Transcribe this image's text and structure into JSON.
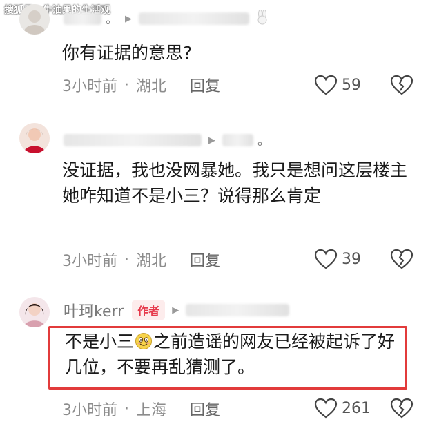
{
  "watermark": "搜狐号@牛油果的生活观",
  "comments": [
    {
      "text": "你有证据的意思?",
      "time": "3小时前",
      "sep": "·",
      "location": "湖北",
      "reply": "回复",
      "likes": "59"
    },
    {
      "text": "没证据，我也没网暴她。我只是想问这层楼主她咋知道不是小三？说得那么肯定",
      "time": "3小时前",
      "sep": "·",
      "location": "湖北",
      "reply": "回复",
      "likes": "39"
    },
    {
      "username": "叶珂kerr",
      "badge": "作者",
      "text_before": "不是小三",
      "text_after": "之前造谣的网友已经被起诉了好几位，不要再乱猜测了。",
      "time": "3小时前",
      "sep": "·",
      "location": "上海",
      "reply": "回复",
      "likes": "261"
    }
  ],
  "icons": {
    "like": "heart-outline-icon",
    "dislike": "broken-heart-icon",
    "expand": "triangle-right-icon",
    "emoji": "smile-emoji-icon"
  },
  "colors": {
    "accent_red": "#e23b3b",
    "badge_bg": "#fdecec",
    "meta_gray": "#8c8c8c"
  }
}
